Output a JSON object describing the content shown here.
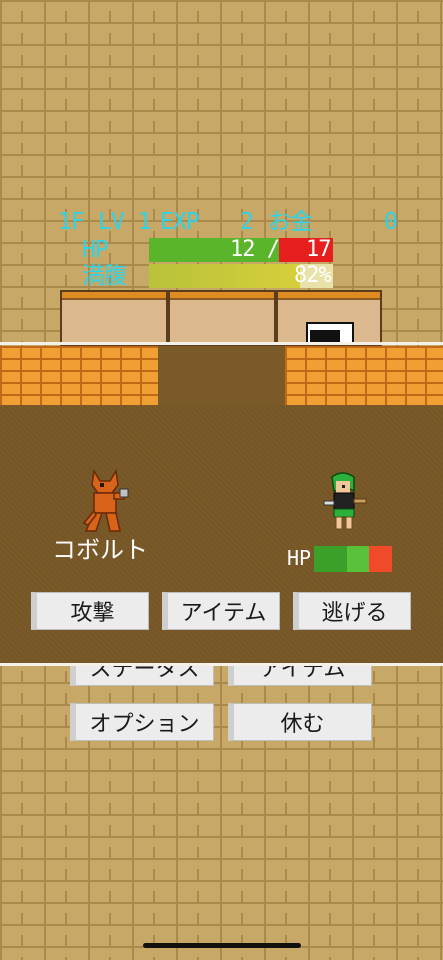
{
  "stats": {
    "floor": "1F",
    "lv_label": "LV",
    "lv": "1",
    "exp_label": "EXP",
    "exp": "2",
    "money_label": "お金",
    "money": "0",
    "hp_label": "HP",
    "hp_current": "12 /",
    "hp_max": "17",
    "hp_fraction": 0.706,
    "hunger_label": "満腹",
    "hunger_value": "82%",
    "hunger_fraction": 0.82
  },
  "battle": {
    "enemy_name": "コボルト",
    "player_hp_label": "HP",
    "player_hp_fraction": 0.71,
    "actions": [
      "攻撃",
      "アイテム",
      "逃げる"
    ]
  },
  "menu": {
    "status_label": "ステータス",
    "item_label": "アイテム",
    "options_label": "オプション",
    "rest_label": "休む"
  },
  "colors": {
    "stat_text": "#2fd3e8",
    "hp_green": "#5ab52a",
    "hp_red": "#e61e1e",
    "hunger_yellow": "#c9c43a"
  }
}
